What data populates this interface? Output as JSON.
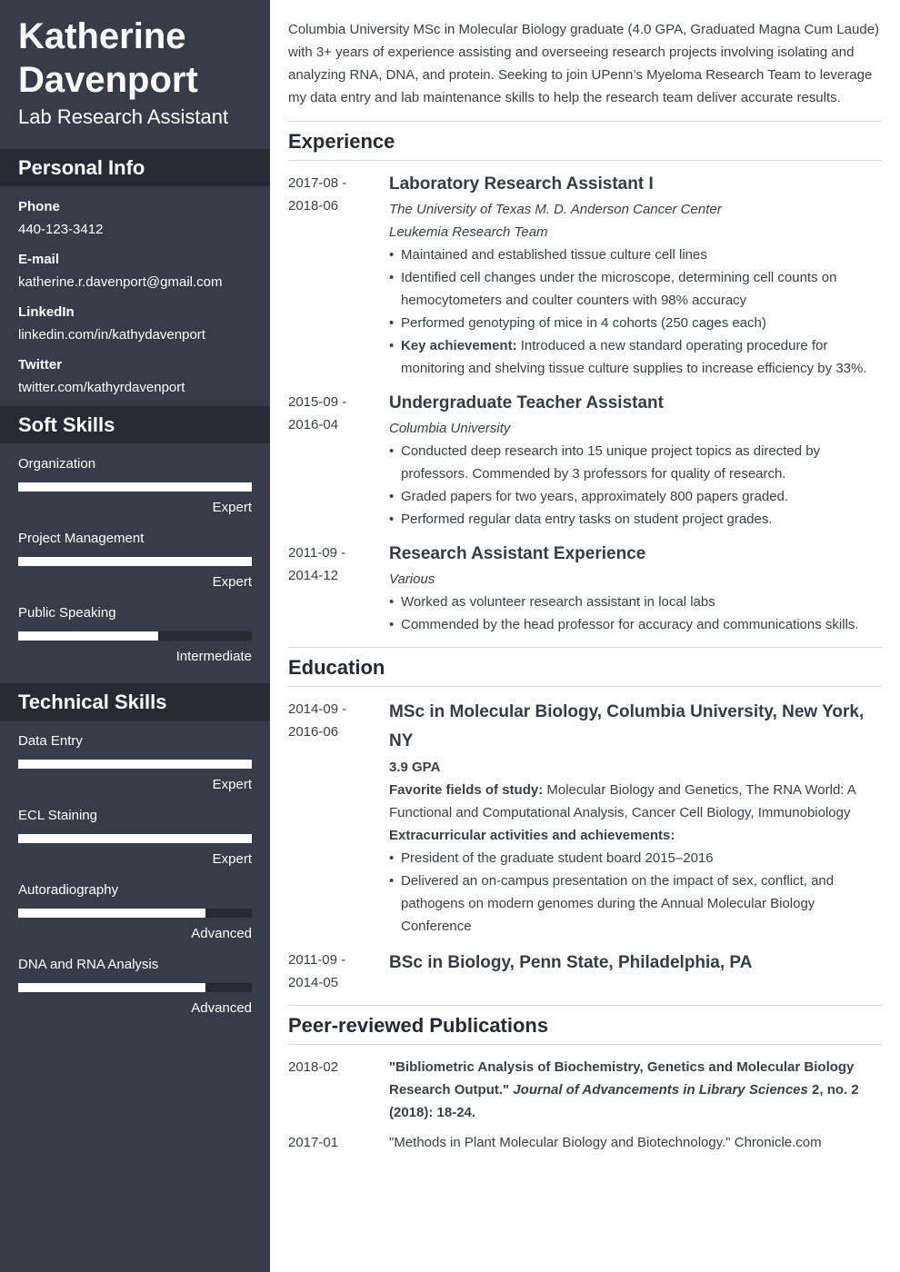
{
  "sidebar": {
    "name_line1": "Katherine",
    "name_line2": "Davenport",
    "title": "Lab Research Assistant",
    "personal_info": {
      "heading": "Personal Info",
      "items": [
        {
          "label": "Phone",
          "value": "440-123-3412"
        },
        {
          "label": "E-mail",
          "value": "katherine.r.davenport@gmail.com"
        },
        {
          "label": "LinkedIn",
          "value": "linkedin.com/in/kathydavenport"
        },
        {
          "label": "Twitter",
          "value": "twitter.com/kathyrdavenport"
        }
      ]
    },
    "soft_skills": {
      "heading": "Soft Skills",
      "items": [
        {
          "name": "Organization",
          "level": "Expert",
          "fill": 1.0
        },
        {
          "name": "Project Management",
          "level": "Expert",
          "fill": 1.0
        },
        {
          "name": "Public Speaking",
          "level": "Intermediate",
          "fill": 0.6
        }
      ]
    },
    "technical_skills": {
      "heading": "Technical Skills",
      "items": [
        {
          "name": "Data Entry",
          "level": "Expert",
          "fill": 1.0
        },
        {
          "name": "ECL Staining",
          "level": "Expert",
          "fill": 1.0
        },
        {
          "name": "Autoradiography",
          "level": "Advanced",
          "fill": 0.8
        },
        {
          "name": "DNA and RNA Analysis",
          "level": "Advanced",
          "fill": 0.8
        }
      ]
    }
  },
  "main": {
    "summary": "Columbia University MSc in Molecular Biology graduate (4.0 GPA, Graduated Magna Cum Laude) with 3+ years of experience assisting and overseeing research projects involving isolating and analyzing RNA, DNA, and protein. Seeking to join UPenn’s Myeloma Research Team to leverage my data entry and lab maintenance skills to help the research team deliver accurate results.",
    "experience": {
      "heading": "Experience",
      "entries": [
        {
          "date_start": "2017-08 -",
          "date_end": "2018-06",
          "title": "Laboratory Research Assistant I",
          "org": "The University of Texas M. D. Anderson Cancer Center",
          "sub_org": "Leukemia Research Team",
          "bullets": [
            "Maintained and established tissue culture cell lines",
            "Identified cell changes under the microscope, determining cell counts on hemocytometers and coulter counters with 98% accuracy",
            "Performed genotyping of mice in 4 cohorts (250 cages each)"
          ],
          "achievement_label": "Key achievement:",
          "achievement_text": " Introduced a new standard operating procedure for monitoring and shelving tissue culture supplies to increase efficiency by 33%."
        },
        {
          "date_start": "2015-09 -",
          "date_end": "2016-04",
          "title": "Undergraduate Teacher Assistant",
          "org": "Columbia University",
          "bullets": [
            "Conducted deep research into 15 unique project topics as directed by professors. Commended by 3 professors for quality of research.",
            "Graded papers for two years, approximately 800 papers graded.",
            "Performed regular data entry tasks on student project grades."
          ]
        },
        {
          "date_start": "2011-09 -",
          "date_end": "2014-12",
          "title": "Research Assistant Experience",
          "org": "Various",
          "bullets": [
            "Worked as volunteer research assistant in local labs",
            "Commended by the head professor for accuracy and communications skills."
          ]
        }
      ]
    },
    "education": {
      "heading": "Education",
      "entries": [
        {
          "date_start": "2014-09 -",
          "date_end": "2016-06",
          "title": "MSc in Molecular Biology, Columbia University, New York, NY",
          "gpa": "3.9 GPA",
          "fields_label": "Favorite fields of study:",
          "fields_text": " Molecular Biology and Genetics, The RNA World: A Functional and Computational Analysis, Cancer Cell Biology, Immunobiology",
          "extra_label": "Extracurricular activities and achievements:",
          "bullets": [
            "President of the graduate student board 2015–2016",
            "Delivered an on-campus presentation on the impact of sex, conflict, and pathogens on modern genomes during the Annual Molecular Biology Conference"
          ]
        },
        {
          "date_start": "2011-09 -",
          "date_end": "2014-05",
          "title": "BSc in Biology, Penn State, Philadelphia, PA"
        }
      ]
    },
    "publications": {
      "heading": "Peer-reviewed Publications",
      "entries": [
        {
          "date": "2018-02",
          "title": "\"Bibliometric Analysis of Biochemistry, Genetics and Molecular Biology Research Output.\"",
          "journal": "Journal of Advancements in Library Sciences",
          "details": " 2, no. 2 (2018): 18-24."
        },
        {
          "date": "2017-01",
          "text": "\"Methods in Plant Molecular Biology and Biotechnology.\" Chronicle.com"
        }
      ]
    }
  }
}
